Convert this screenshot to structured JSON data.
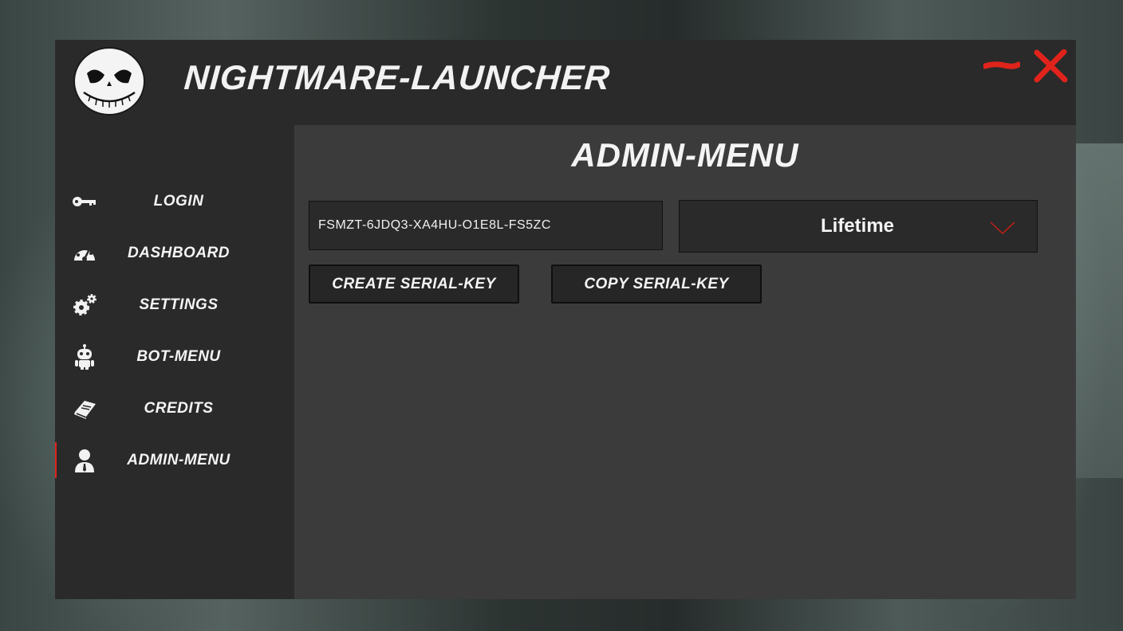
{
  "app": {
    "title": "NIGHTMARE-LAUNCHER",
    "logo_icon": "skull-logo-icon"
  },
  "window_controls": {
    "minimize_icon": "minimize-icon",
    "close_icon": "close-icon",
    "accent": "#e0231b"
  },
  "sidebar": {
    "items": [
      {
        "label": "LOGIN",
        "icon": "key-icon"
      },
      {
        "label": "DASHBOARD",
        "icon": "dashboard-icon"
      },
      {
        "label": "SETTINGS",
        "icon": "gears-icon"
      },
      {
        "label": "BOT-MENU",
        "icon": "robot-icon"
      },
      {
        "label": "CREDITS",
        "icon": "book-icon"
      },
      {
        "label": "ADMIN-MENU",
        "icon": "user-icon",
        "active": true
      }
    ]
  },
  "main": {
    "title": "ADMIN-MENU",
    "serial_key_value": "FSMZT-6JDQ3-XA4HU-O1E8L-FS5ZC",
    "duration": {
      "selected": "Lifetime",
      "icon": "chevron-down-icon"
    },
    "create_button_label": "CREATE SERIAL-KEY",
    "copy_button_label": "COPY SERIAL-KEY"
  }
}
